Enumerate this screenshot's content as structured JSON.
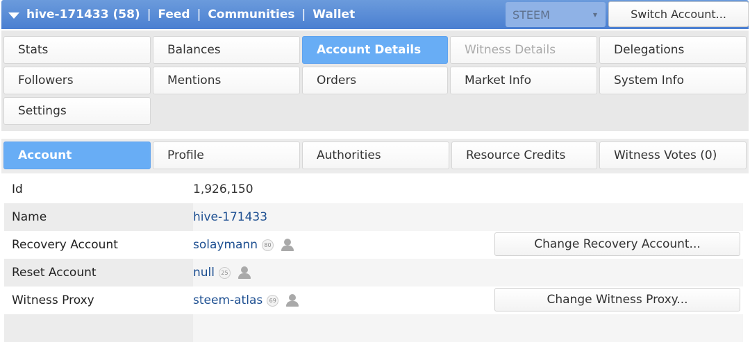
{
  "header": {
    "account": "hive-171433 (58)",
    "nav": [
      "Feed",
      "Communities",
      "Wallet"
    ],
    "separator": "|",
    "chain": "STEEM",
    "chain_arrow": "▼",
    "switch_label": "Switch Account..."
  },
  "tabs": {
    "row1": [
      "Stats",
      "Balances",
      "Account Details",
      "Witness Details",
      "Delegations"
    ],
    "row2": [
      "Followers",
      "Mentions",
      "Orders",
      "Market Info",
      "System Info"
    ],
    "row3": [
      "Settings"
    ],
    "active": "Account Details",
    "disabled": "Witness Details"
  },
  "subtabs": {
    "items": [
      "Account",
      "Profile",
      "Authorities",
      "Resource Credits",
      "Witness Votes (0)"
    ],
    "active": "Account"
  },
  "details": {
    "id": {
      "label": "Id",
      "value": "1,926,150"
    },
    "name": {
      "label": "Name",
      "value": "hive-171433"
    },
    "recovery": {
      "label": "Recovery Account",
      "value": "solaymann",
      "rep": "80",
      "button": "Change Recovery Account..."
    },
    "reset": {
      "label": "Reset Account",
      "value": "null",
      "rep": "25"
    },
    "proxy": {
      "label": "Witness Proxy",
      "value": "steem-atlas",
      "rep": "69",
      "button": "Change Witness Proxy..."
    }
  },
  "colors": {
    "header_bg": "#4a7fd1",
    "active_tab": "#68adf5",
    "link": "#1d4f91"
  }
}
